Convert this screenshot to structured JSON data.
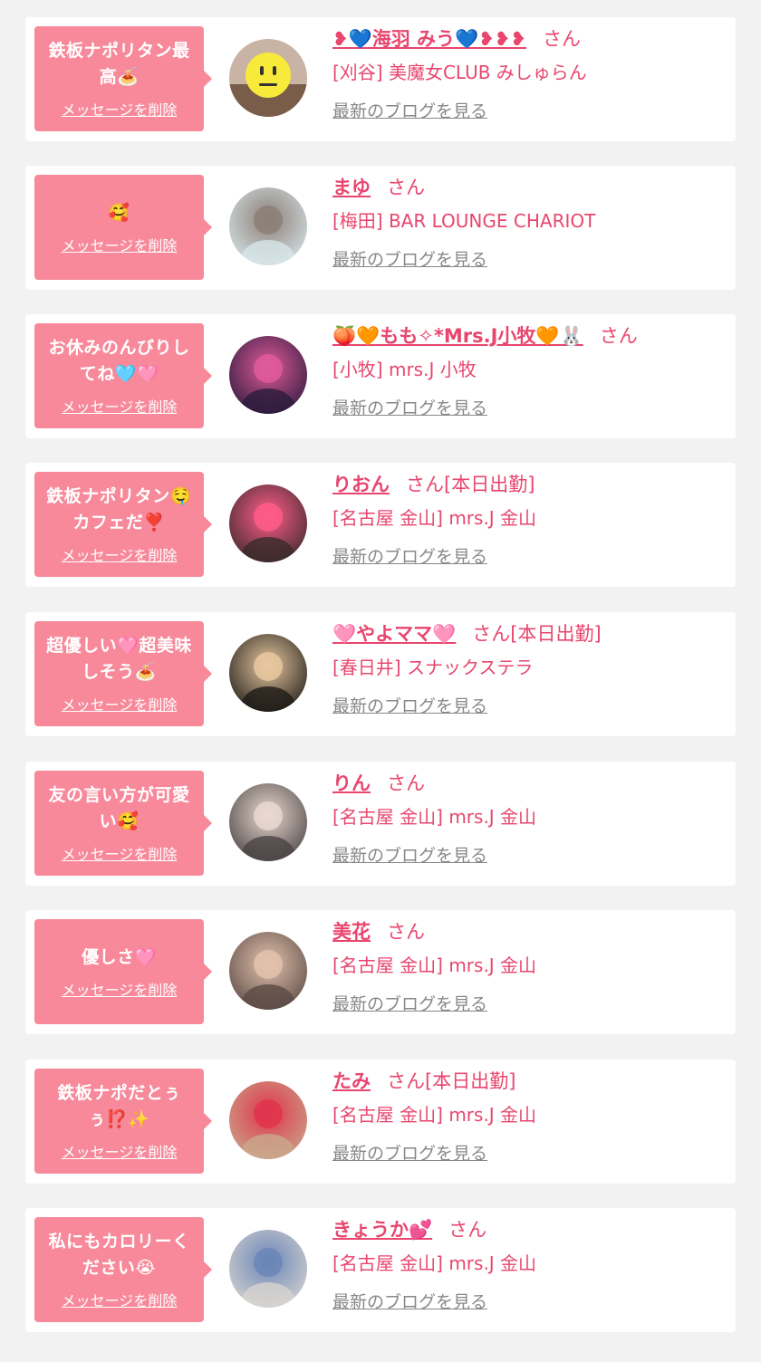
{
  "items": [
    {
      "message": "鉄板ナポリタン最高🍝",
      "delete_label": "メッセージを削除",
      "name": "❥💙海羽 みう💙❥❥❥",
      "suffix": "さん",
      "shop": "[刈谷] 美魔女CLUB みしゅらん",
      "blog_label": "最新のブログを見る",
      "avatar_icon": "smiley-face-avatar"
    },
    {
      "message": "🥰",
      "delete_label": "メッセージを削除",
      "name": "まゆ",
      "suffix": "さん",
      "shop": "[梅田] BAR LOUNGE CHARIOT",
      "blog_label": "最新のブログを見る",
      "avatar_icon": "illustration-avatar"
    },
    {
      "message": "お休みのんびりしてね🩵🩷",
      "delete_label": "メッセージを削除",
      "name": "🍑🧡もも✧*Mrs.J小牧🧡🐰",
      "suffix": "さん",
      "shop": "[小牧] mrs.J 小牧",
      "blog_label": "最新のブログを見る",
      "avatar_icon": "photo-avatar"
    },
    {
      "message": "鉄板ナポリタン🤤カフェだ❣️",
      "delete_label": "メッセージを削除",
      "name": "りおん",
      "suffix": "さん[本日出勤]",
      "shop": "[名古屋 金山] mrs.J 金山",
      "blog_label": "最新のブログを見る",
      "avatar_icon": "photo-avatar"
    },
    {
      "message": "超優しい🩷超美味しそう🍝",
      "delete_label": "メッセージを削除",
      "name": "🩷やよママ🩷",
      "suffix": "さん[本日出勤]",
      "shop": "[春日井] スナックステラ",
      "blog_label": "最新のブログを見る",
      "avatar_icon": "photo-avatar"
    },
    {
      "message": "友の言い方が可愛い🥰",
      "delete_label": "メッセージを削除",
      "name": "りん",
      "suffix": "さん",
      "shop": "[名古屋 金山] mrs.J 金山",
      "blog_label": "最新のブログを見る",
      "avatar_icon": "photo-avatar"
    },
    {
      "message": "優しさ🩷",
      "delete_label": "メッセージを削除",
      "name": "美花",
      "suffix": "さん",
      "shop": "[名古屋 金山] mrs.J 金山",
      "blog_label": "最新のブログを見る",
      "avatar_icon": "photo-avatar"
    },
    {
      "message": "鉄板ナポだとぅぅ⁉️✨",
      "delete_label": "メッセージを削除",
      "name": "たみ",
      "suffix": "さん[本日出勤]",
      "shop": "[名古屋 金山] mrs.J 金山",
      "blog_label": "最新のブログを見る",
      "avatar_icon": "photo-avatar"
    },
    {
      "message": "私にもカロリーください😭",
      "delete_label": "メッセージを削除",
      "name": "きょうか💕",
      "suffix": "さん",
      "shop": "[名古屋 金山] mrs.J 金山",
      "blog_label": "最新のブログを見る",
      "avatar_icon": "photo-avatar"
    }
  ],
  "colors": {
    "page_bg": "#f2f2f2",
    "bubble": "#f7899a",
    "accent": "#e8466e",
    "link_gray": "#888888"
  }
}
